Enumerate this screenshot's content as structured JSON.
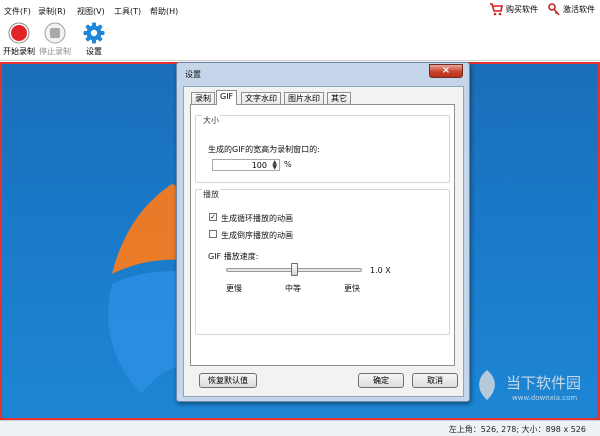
{
  "menubar": {
    "items": [
      "文件(F)",
      "录制(R)",
      "视图(V)",
      "工具(T)",
      "帮助(H)"
    ],
    "buy_label": "购买软件",
    "activate_label": "激活软件"
  },
  "toolbar": {
    "start_label": "开始录制",
    "stop_label": "停止录制",
    "settings_label": "设置"
  },
  "dialog": {
    "title": "设置",
    "close_glyph": "×",
    "tabs": [
      "录制",
      "GIF",
      "文字水印",
      "图片水印",
      "其它"
    ],
    "selected_tab": "GIF",
    "size_group": {
      "label": "大小",
      "prompt": "生成的GIF的宽高为录制窗口的:",
      "value": "100",
      "unit": "%"
    },
    "play_group": {
      "label": "播放",
      "loop_label": "生成循环播放的动画",
      "loop_checked": true,
      "reverse_label": "生成倒序播放的动画",
      "reverse_checked": false,
      "speed_label": "GIF 播放速度:",
      "speed_value": "1.0 X",
      "speed_position": 0.5,
      "tick_slow": "更慢",
      "tick_mid": "中等",
      "tick_fast": "更快"
    },
    "restore_label": "恢复默认值",
    "ok_label": "确定",
    "cancel_label": "取消"
  },
  "statusbar": {
    "text": "左上角：526, 278; 大小：898 x 526"
  },
  "watermark": {
    "text": "当下软件园",
    "subtext": "www.downxia.com"
  },
  "colors": {
    "record_red": "#e3232a",
    "close_red": "#c9432c",
    "desktop_blue": "#1a78c8",
    "capture_border": "#e6312f"
  }
}
